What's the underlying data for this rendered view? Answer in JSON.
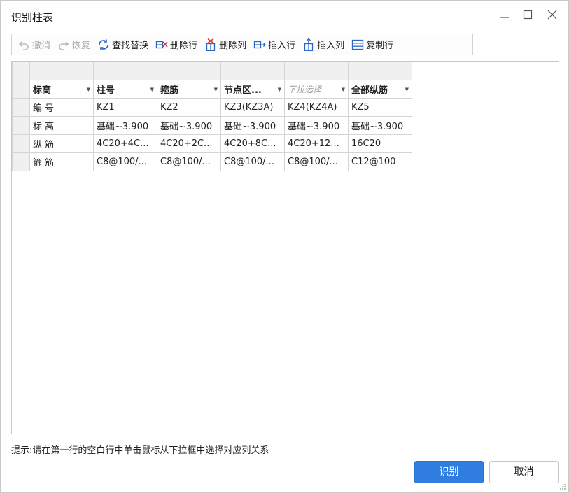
{
  "window": {
    "title": "识别柱表"
  },
  "toolbar": {
    "undo": "撤消",
    "redo": "恢复",
    "find_replace": "查找替换",
    "delete_row": "删除行",
    "delete_col": "删除列",
    "insert_row": "插入行",
    "insert_col": "插入列",
    "copy_row": "复制行"
  },
  "grid": {
    "headers": [
      "标高",
      "柱号",
      "箍筋",
      "节点区...",
      "下拉选择",
      "全部纵筋"
    ],
    "rows": [
      [
        "编 号",
        "KZ1",
        "KZ2",
        "KZ3(KZ3A)",
        "KZ4(KZ4A)",
        "KZ5"
      ],
      [
        "标 高",
        "基础~3.900",
        "基础~3.900",
        "基础~3.900",
        "基础~3.900",
        "基础~3.900"
      ],
      [
        "纵 筋",
        "4C20+4C...",
        "4C20+2C...",
        "4C20+8C...",
        "4C20+12...",
        "16C20"
      ],
      [
        "箍 筋",
        "C8@100/...",
        "C8@100/...",
        "C8@100/...",
        "C8@100/...",
        "C12@100"
      ]
    ]
  },
  "hint": "提示:请在第一行的空白行中单击鼠标从下拉框中选择对应列关系",
  "buttons": {
    "ok": "识别",
    "cancel": "取消"
  },
  "colors": {
    "primary": "#2f7de1",
    "delete_red": "#d9342b",
    "icon_blue": "#2b66c4"
  }
}
